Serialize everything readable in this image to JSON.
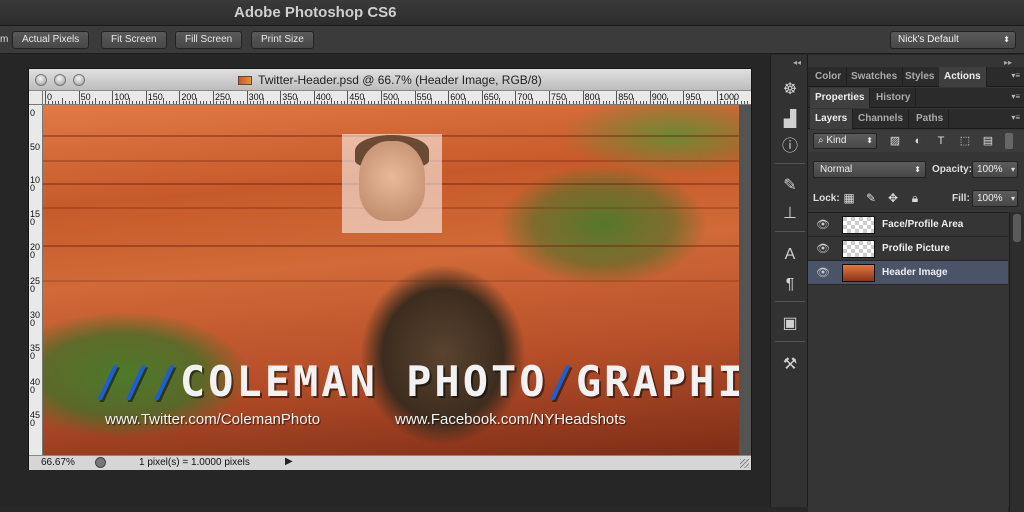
{
  "app": {
    "title": "Adobe Photoshop CS6"
  },
  "options_bar": {
    "left_fragment": "m",
    "buttons": [
      "Actual Pixels",
      "Fit Screen",
      "Fill Screen",
      "Print Size"
    ],
    "workspace": "Nick's Default"
  },
  "document": {
    "title": "Twitter-Header.psd @ 66.7% (Header Image, RGB/8)",
    "ruler_h": [
      "0",
      "50",
      "100",
      "150",
      "200",
      "250",
      "300",
      "350",
      "400",
      "450",
      "500",
      "550",
      "600",
      "650",
      "700",
      "750",
      "800",
      "850",
      "900",
      "950",
      "1000"
    ],
    "ruler_v": [
      "0",
      "50",
      "100",
      "150",
      "200",
      "250",
      "300",
      "350",
      "400",
      "450"
    ],
    "brand_slashes_left": "///",
    "brand_name": "COLEMAN PHOTO",
    "brand_slash_mid": "/",
    "brand_name2": "GRAPHIX",
    "brand_slashes_right": "///",
    "twitter_url": "www.Twitter.com/ColemanPhoto",
    "facebook_url": "www.Facebook.com/NYHeadshots",
    "zoom": "66.67%",
    "pixel_info": "1 pixel(s) = 1.0000 pixels"
  },
  "panels": {
    "top_tabs": [
      "Color",
      "Swatches",
      "Styles",
      "Actions"
    ],
    "mid_tabs": [
      "Properties",
      "History"
    ],
    "layer_tabs": [
      "Layers",
      "Channels",
      "Paths"
    ],
    "filter_kind": "Kind",
    "blend_mode": "Normal",
    "opacity_label": "Opacity:",
    "opacity_value": "100%",
    "lock_label": "Lock:",
    "fill_label": "Fill:",
    "fill_value": "100%",
    "layers": [
      {
        "name": "Face/Profile Area",
        "selected": false
      },
      {
        "name": "Profile Picture",
        "selected": false
      },
      {
        "name": "Header Image",
        "selected": true
      }
    ]
  },
  "icons": {
    "tool_strip": [
      "ship-wheel-icon",
      "histogram-icon",
      "info-icon",
      "brush-presets-icon",
      "clone-source-icon",
      "character-icon",
      "paragraph-icon",
      "layer-comps-icon",
      "tool-presets-icon"
    ]
  }
}
